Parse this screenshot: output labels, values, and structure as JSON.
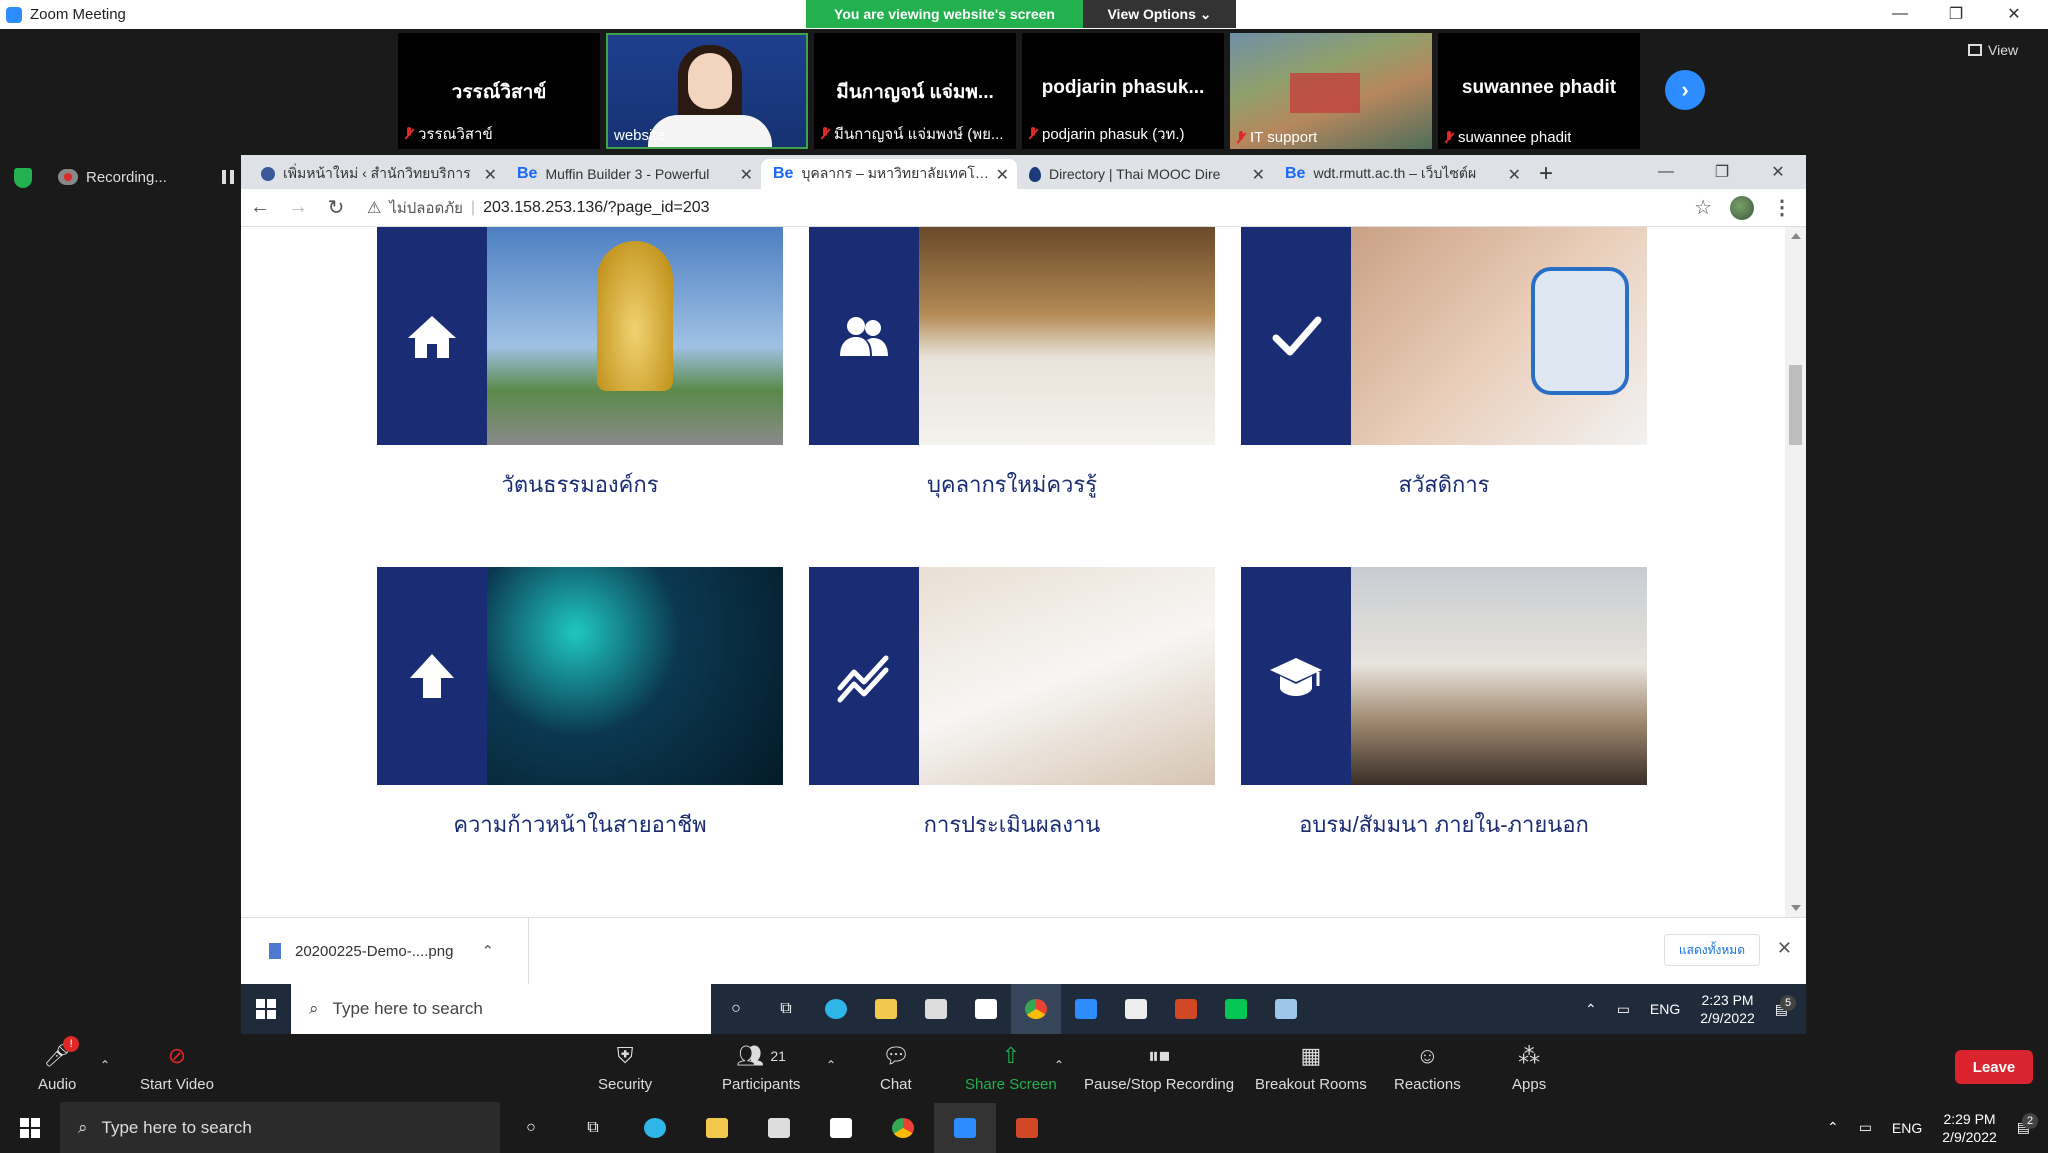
{
  "zoom": {
    "window_title": "Zoom Meeting",
    "viewing_banner": "You are viewing website's screen",
    "view_options": "View Options",
    "view_button": "View",
    "recording_label": "Recording...",
    "participants": [
      {
        "big_name": "วรรณ์วิสาข์",
        "sub_name": "วรรณวิสาข์",
        "type": "name"
      },
      {
        "big_name": "",
        "sub_name": "website",
        "type": "video"
      },
      {
        "big_name": "มีนกาญจน์ แจ่มพ...",
        "sub_name": "มีนกาญจน์ แจ่มพงษ์ (พย...",
        "type": "name"
      },
      {
        "big_name": "podjarin  phasuk...",
        "sub_name": "podjarin phasuk (วท.)",
        "type": "name"
      },
      {
        "big_name": "",
        "sub_name": "IT support",
        "type": "image"
      },
      {
        "big_name": "suwannee phadit",
        "sub_name": "suwannee phadit",
        "type": "name"
      }
    ],
    "controls": {
      "audio": "Audio",
      "start_video": "Start Video",
      "security": "Security",
      "participants": "Participants",
      "participants_count": "21",
      "chat": "Chat",
      "share_screen": "Share Screen",
      "pause_stop_recording": "Pause/Stop Recording",
      "breakout_rooms": "Breakout Rooms",
      "reactions": "Reactions",
      "apps": "Apps",
      "leave": "Leave",
      "audio_badge": "!"
    }
  },
  "browser": {
    "tabs": [
      {
        "title": "เพิ่มหน้าใหม่ ‹ สำนักวิทยบริการ",
        "favicon": "globe-icon",
        "active": false
      },
      {
        "title": "Muffin Builder 3 - Powerful",
        "favicon": "Be",
        "active": false
      },
      {
        "title": "บุคลากร – มหาวิทยาลัยเทคโนโล",
        "favicon": "Be",
        "active": true
      },
      {
        "title": "Directory | Thai MOOC Dire",
        "favicon": "drop-icon",
        "active": false
      },
      {
        "title": "wdt.rmutt.ac.th – เว็บไซต์ผ",
        "favicon": "Be",
        "active": false
      }
    ],
    "insecure_label": "ไม่ปลอดภัย",
    "url": "203.158.253.136/?page_id=203",
    "cards": [
      {
        "caption": "วัตนธรรมองค์กร",
        "icon": "home-icon"
      },
      {
        "caption": "บุคลากรใหม่ควรรู้",
        "icon": "users-icon"
      },
      {
        "caption": "สวัสดิการ",
        "icon": "check-icon"
      },
      {
        "caption": "ความก้าวหน้าในสายอาชีพ",
        "icon": "arrow-up-icon"
      },
      {
        "caption": "การประเมินผลงาน",
        "icon": "trend-icon"
      },
      {
        "caption": "อบรม/สัมมนา ภายใน-ภายนอก",
        "icon": "graduation-cap-icon"
      }
    ],
    "download": {
      "file": "20200225-Demo-....png",
      "show_all": "แสดงทั้งหมด"
    }
  },
  "inner_taskbar": {
    "search_placeholder": "Type here to search",
    "lang": "ENG",
    "time": "2:23 PM",
    "date": "2/9/2022"
  },
  "outer_taskbar": {
    "search_placeholder": "Type here to search",
    "lang": "ENG",
    "time": "2:29 PM",
    "date": "2/9/2022",
    "notifications": "2",
    "inner_notifications": "5"
  },
  "colors": {
    "brand_blue": "#1a2c74",
    "zoom_blue": "#2d8cff",
    "share_green": "#23b04f",
    "leave_red": "#d9232e"
  }
}
